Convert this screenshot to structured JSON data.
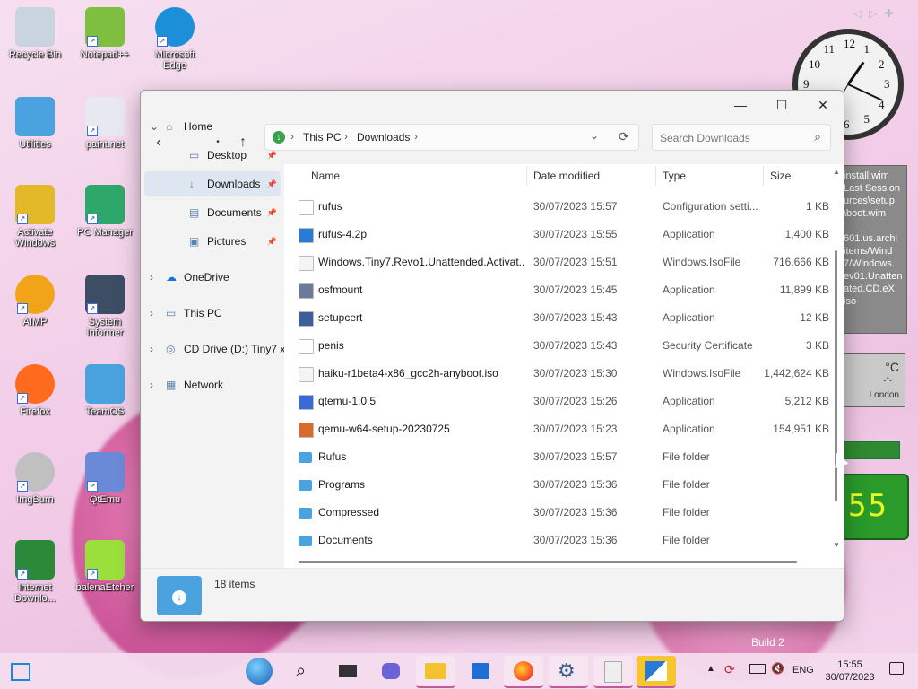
{
  "desktop": {
    "icons": [
      {
        "label": "Recycle Bin",
        "icon": "recycle-bin-icon"
      },
      {
        "label": "Notepad++",
        "icon": "notepad-plus-plus-icon"
      },
      {
        "label": "Microsoft Edge",
        "icon": "edge-icon"
      },
      {
        "label": "Utilities",
        "icon": "folder-icon"
      },
      {
        "label": "paint.net",
        "icon": "paintnet-icon"
      },
      {
        "label": "Activate Windows",
        "icon": "key-icon"
      },
      {
        "label": "PC Manager",
        "icon": "pc-manager-icon"
      },
      {
        "label": "AIMP",
        "icon": "aimp-icon"
      },
      {
        "label": "System Informer",
        "icon": "system-informer-icon"
      },
      {
        "label": "Firefox",
        "icon": "firefox-icon"
      },
      {
        "label": "TeamOS",
        "icon": "folder-icon"
      },
      {
        "label": "ImgBurn",
        "icon": "imgburn-icon"
      },
      {
        "label": "QtEmu",
        "icon": "qtemu-icon"
      },
      {
        "label": "Internet Downlo...",
        "icon": "idm-icon"
      },
      {
        "label": "balenaEtcher",
        "icon": "balena-etcher-icon"
      }
    ],
    "watermark_build": "Build 2"
  },
  "gadgets": {
    "clock_numbers": [
      "12",
      "1",
      "2",
      "3",
      "4",
      "5",
      "6",
      "7",
      "8",
      "9",
      "10",
      "11"
    ],
    "notes_lines": [
      "install.wim",
      "Last Session",
      "urces\\setup",
      "\\boot.wim",
      "",
      "601.us.archi",
      "items/Wind",
      "7/Windows.",
      "ev01.Unatten",
      "ated.CD.eX",
      "iso"
    ],
    "weather": {
      "unit": "°C",
      "value": "-°-",
      "city": "London"
    },
    "digital_clock": "55"
  },
  "explorer": {
    "breadcrumb": {
      "root": "This PC",
      "folder": "Downloads"
    },
    "search_placeholder": "Search Downloads",
    "sidebar": [
      {
        "label": "Home",
        "expand": "⌄",
        "pinned": false
      },
      {
        "label": "Desktop",
        "pinned": true
      },
      {
        "label": "Downloads",
        "pinned": true,
        "selected": true
      },
      {
        "label": "Documents",
        "pinned": true
      },
      {
        "label": "Pictures",
        "pinned": true
      },
      {
        "label": "OneDrive",
        "expand": "›"
      },
      {
        "label": "This PC",
        "expand": "›"
      },
      {
        "label": "CD Drive (D:) Tiny7 x",
        "expand": "›"
      },
      {
        "label": "Network",
        "expand": "›"
      }
    ],
    "columns": {
      "name": "Name",
      "date": "Date modified",
      "type": "Type",
      "size": "Size"
    },
    "files": [
      {
        "name": "rufus",
        "date": "30/07/2023 15:57",
        "type": "Configuration setti...",
        "size": "1 KB",
        "icon": "config-file-icon"
      },
      {
        "name": "rufus-4.2p",
        "date": "30/07/2023 15:55",
        "type": "Application",
        "size": "1,400 KB",
        "icon": "rufus-app-icon"
      },
      {
        "name": "Windows.Tiny7.Revo1.Unattended.Activat...",
        "date": "30/07/2023 15:51",
        "type": "Windows.IsoFile",
        "size": "716,666 KB",
        "icon": "iso-file-icon"
      },
      {
        "name": "osfmount",
        "date": "30/07/2023 15:45",
        "type": "Application",
        "size": "11,899 KB",
        "icon": "osfmount-app-icon"
      },
      {
        "name": "setupcert",
        "date": "30/07/2023 15:43",
        "type": "Application",
        "size": "12 KB",
        "icon": "window-app-icon"
      },
      {
        "name": "penis",
        "date": "30/07/2023 15:43",
        "type": "Security Certificate",
        "size": "3 KB",
        "icon": "certificate-icon"
      },
      {
        "name": "haiku-r1beta4-x86_gcc2h-anyboot.iso",
        "date": "30/07/2023 15:30",
        "type": "Windows.IsoFile",
        "size": "1,442,624 KB",
        "icon": "iso-file-icon"
      },
      {
        "name": "qtemu-1.0.5",
        "date": "30/07/2023 15:26",
        "type": "Application",
        "size": "5,212 KB",
        "icon": "qtemu-app-icon"
      },
      {
        "name": "qemu-w64-setup-20230725",
        "date": "30/07/2023 15:23",
        "type": "Application",
        "size": "154,951 KB",
        "icon": "qemu-app-icon"
      },
      {
        "name": "Rufus",
        "date": "30/07/2023 15:57",
        "type": "File folder",
        "size": "",
        "icon": "folder-icon"
      },
      {
        "name": "Programs",
        "date": "30/07/2023 15:36",
        "type": "File folder",
        "size": "",
        "icon": "folder-icon"
      },
      {
        "name": "Compressed",
        "date": "30/07/2023 15:36",
        "type": "File folder",
        "size": "",
        "icon": "folder-icon"
      },
      {
        "name": "Documents",
        "date": "30/07/2023 15:36",
        "type": "File folder",
        "size": "",
        "icon": "folder-icon"
      }
    ],
    "status": {
      "count": "18 items"
    }
  },
  "taskbar": {
    "language": "ENG",
    "time": "15:55",
    "date": "30/07/2023"
  },
  "colors": {
    "accent": "#0067c0",
    "folder": "#4aa3df",
    "selected": "#dde6f1"
  }
}
